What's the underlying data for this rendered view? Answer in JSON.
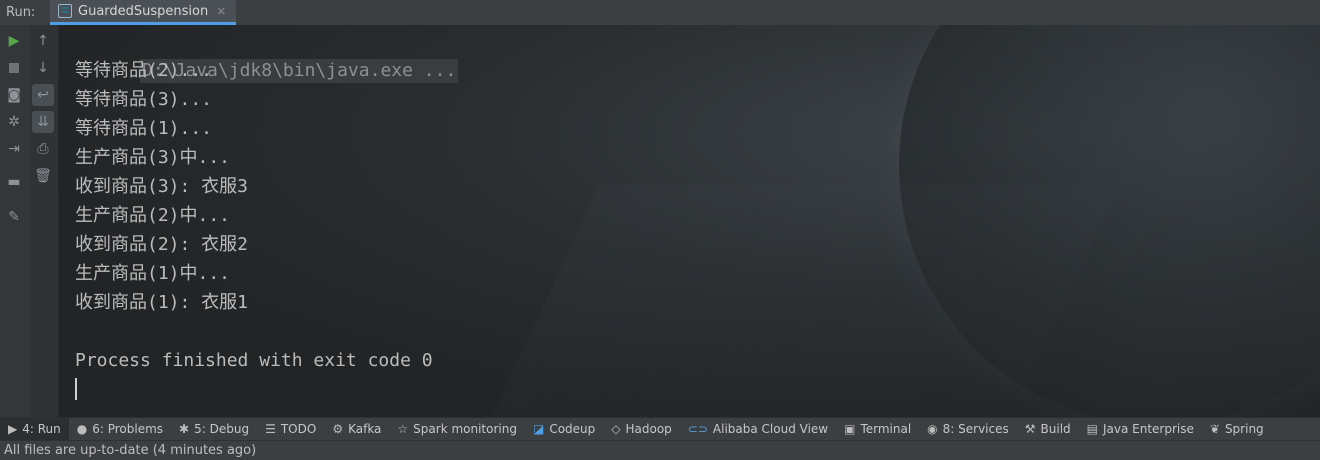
{
  "header": {
    "run_label": "Run:",
    "tab_title": "GuardedSuspension",
    "tab_close": "×"
  },
  "console": {
    "command": "D:\\Java\\jdk8\\bin\\java.exe ...",
    "lines": [
      "等待商品(2)...",
      "等待商品(3)...",
      "等待商品(1)...",
      "生产商品(3)中...",
      "收到商品(3): 衣服3",
      "生产商品(2)中...",
      "收到商品(2): 衣服2",
      "生产商品(1)中...",
      "收到商品(1): 衣服1"
    ],
    "exit_message": "Process finished with exit code 0"
  },
  "toolwindows": [
    {
      "label": "4: Run",
      "icon": "▶"
    },
    {
      "label": "6: Problems",
      "icon": "●"
    },
    {
      "label": "5: Debug",
      "icon": "✱"
    },
    {
      "label": "TODO",
      "icon": "☰"
    },
    {
      "label": "Kafka",
      "icon": "⚙"
    },
    {
      "label": "Spark monitoring",
      "icon": "☆"
    },
    {
      "label": "Codeup",
      "icon": "◪"
    },
    {
      "label": "Hadoop",
      "icon": "◇"
    },
    {
      "label": "Alibaba Cloud View",
      "icon": "⊂⊃"
    },
    {
      "label": "Terminal",
      "icon": "▣"
    },
    {
      "label": "8: Services",
      "icon": "◉"
    },
    {
      "label": "Build",
      "icon": "⚒"
    },
    {
      "label": "Java Enterprise",
      "icon": "▤"
    },
    {
      "label": "Spring",
      "icon": "❦"
    }
  ],
  "status": {
    "text": "All files are up-to-date (4 minutes ago)"
  },
  "colors": {
    "accent": "#4f9ee3",
    "run_green": "#57a64a",
    "console_text": "#bcbcbc"
  }
}
